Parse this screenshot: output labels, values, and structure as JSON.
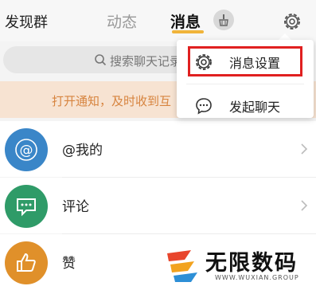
{
  "header": {
    "left_title": "发现群",
    "tabs": [
      {
        "label": "动态",
        "active": false
      },
      {
        "label": "消息",
        "active": true
      }
    ]
  },
  "search": {
    "placeholder": "搜索聊天记录"
  },
  "notice": {
    "text": "打开通知，及时收到互"
  },
  "list": [
    {
      "label": "@我的",
      "icon": "at-icon",
      "color": "#3a86c8"
    },
    {
      "label": "评论",
      "icon": "comment-icon",
      "color": "#2f9b68"
    },
    {
      "label": "赞",
      "icon": "thumbs-up-icon",
      "color": "#e0902a"
    }
  ],
  "popup_menu": {
    "items": [
      {
        "label": "消息设置",
        "icon": "gear-icon",
        "highlighted": true
      },
      {
        "label": "发起聊天",
        "icon": "chat-bubble-icon",
        "highlighted": false
      }
    ]
  },
  "watermark": {
    "title": "无限数码",
    "subtitle": "WWW.WUXIAN.GROUP"
  },
  "colors": {
    "accent": "#f0b43a",
    "notice_text": "#d7843f",
    "highlight": "#e02020"
  }
}
